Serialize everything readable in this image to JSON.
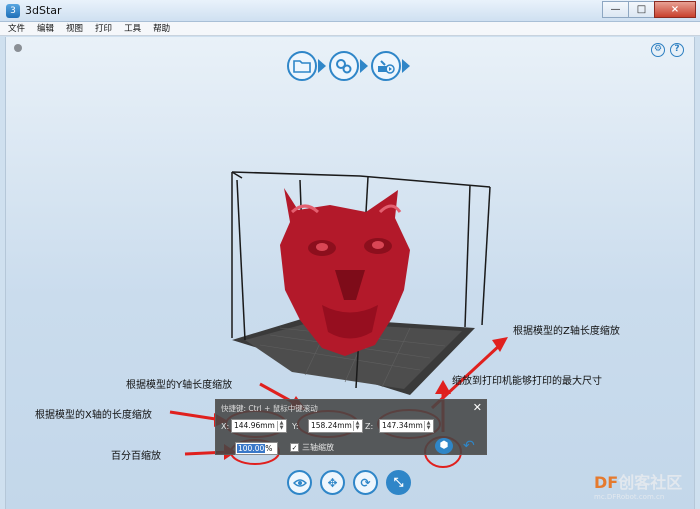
{
  "window": {
    "title": "3dStar",
    "controls": [
      "—",
      "□",
      "×"
    ]
  },
  "menu": [
    "文件",
    "编辑",
    "视图",
    "打印",
    "工具",
    "帮助"
  ],
  "scale_panel": {
    "shortcut": "快捷键: Ctrl + 鼠标中键滚动",
    "x_label": "X:",
    "x_value": "144.96mm",
    "y_label": "Y:",
    "y_value": "158.24mm",
    "z_label": "Z:",
    "z_value": "147.34mm",
    "percent_value": "100.00",
    "percent_sign": "%",
    "uniform_label": "三轴缩放",
    "uniform_checked": true
  },
  "annotations": {
    "z_axis": "根据模型的Z轴长度缩放",
    "max_size": "缩放到打印机能够打印的最大尺寸",
    "y_axis": "根据模型的Y轴长度缩放",
    "x_axis": "根据模型的X轴的长度缩放",
    "percent": "百分百缩放"
  },
  "watermark": {
    "brand_prefix": "DF",
    "brand_rest": "创客社区",
    "site": "mc.DFRobot.com.cn"
  },
  "colors": {
    "accent": "#2f86c8",
    "model_red": "#b3192a",
    "annotation_red": "#e0201e",
    "platform": "#3a3a3a"
  },
  "icons": {
    "open": "folder-icon",
    "model_library": "gears-icon",
    "print": "print-icon",
    "view": "eye-icon",
    "move": "move-icon",
    "rotate": "rotate-icon",
    "scale": "scale-icon"
  }
}
